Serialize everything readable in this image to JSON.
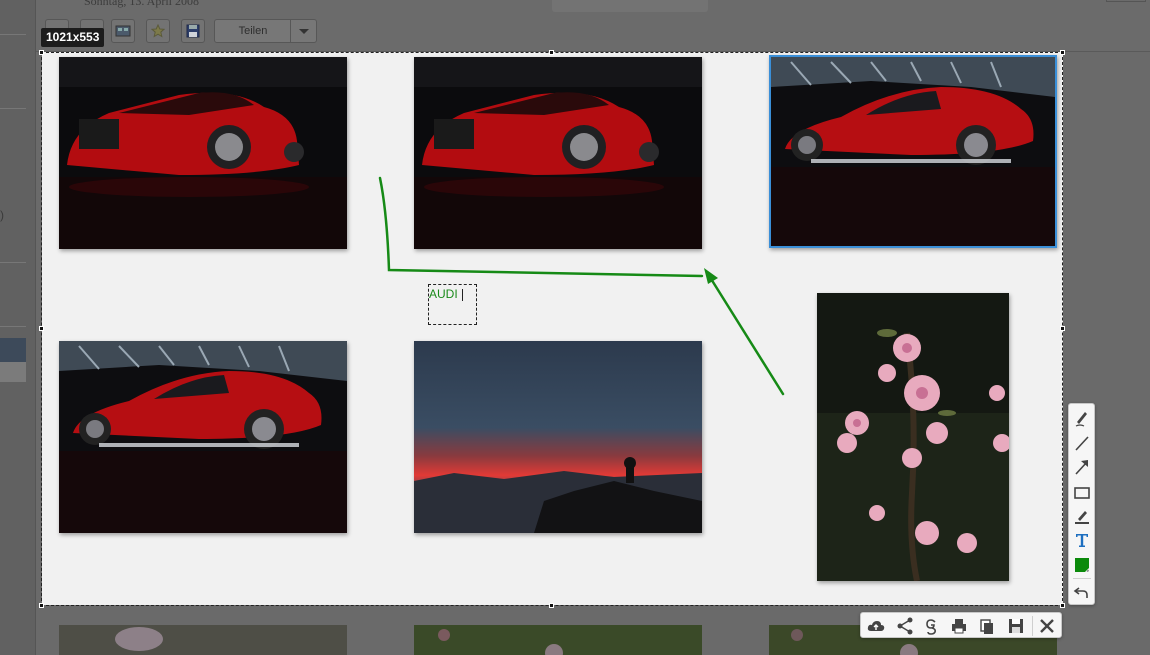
{
  "app": {
    "header_date": "Sonntag, 13. April 2008",
    "share_label": "Teilen",
    "sidebar_paren": ")"
  },
  "capture": {
    "dimensions_label": "1021x553",
    "text_annotation": "AUDI"
  },
  "photos": [
    {
      "name": "red-audi-front-photo-1"
    },
    {
      "name": "red-audi-front-photo-2"
    },
    {
      "name": "red-audi-side-photo-selected"
    },
    {
      "name": "red-audi-side-photo-2"
    },
    {
      "name": "sunset-photo"
    },
    {
      "name": "peach-blossom-photo"
    }
  ],
  "draw_tools": [
    "freehand-tool",
    "line-tool",
    "arrow-tool",
    "rectangle-tool",
    "marker-tool",
    "text-tool",
    "color-picker",
    "undo-tool"
  ],
  "action_tools": [
    "upload-cloud",
    "share",
    "google-search",
    "print",
    "copy",
    "save",
    "close"
  ],
  "colors": {
    "annotation": "#1a8a1a",
    "selected_border": "#3a8fd8",
    "capture_bg": "#f1f1f1",
    "dim_overlay": "#6a6a6a"
  }
}
